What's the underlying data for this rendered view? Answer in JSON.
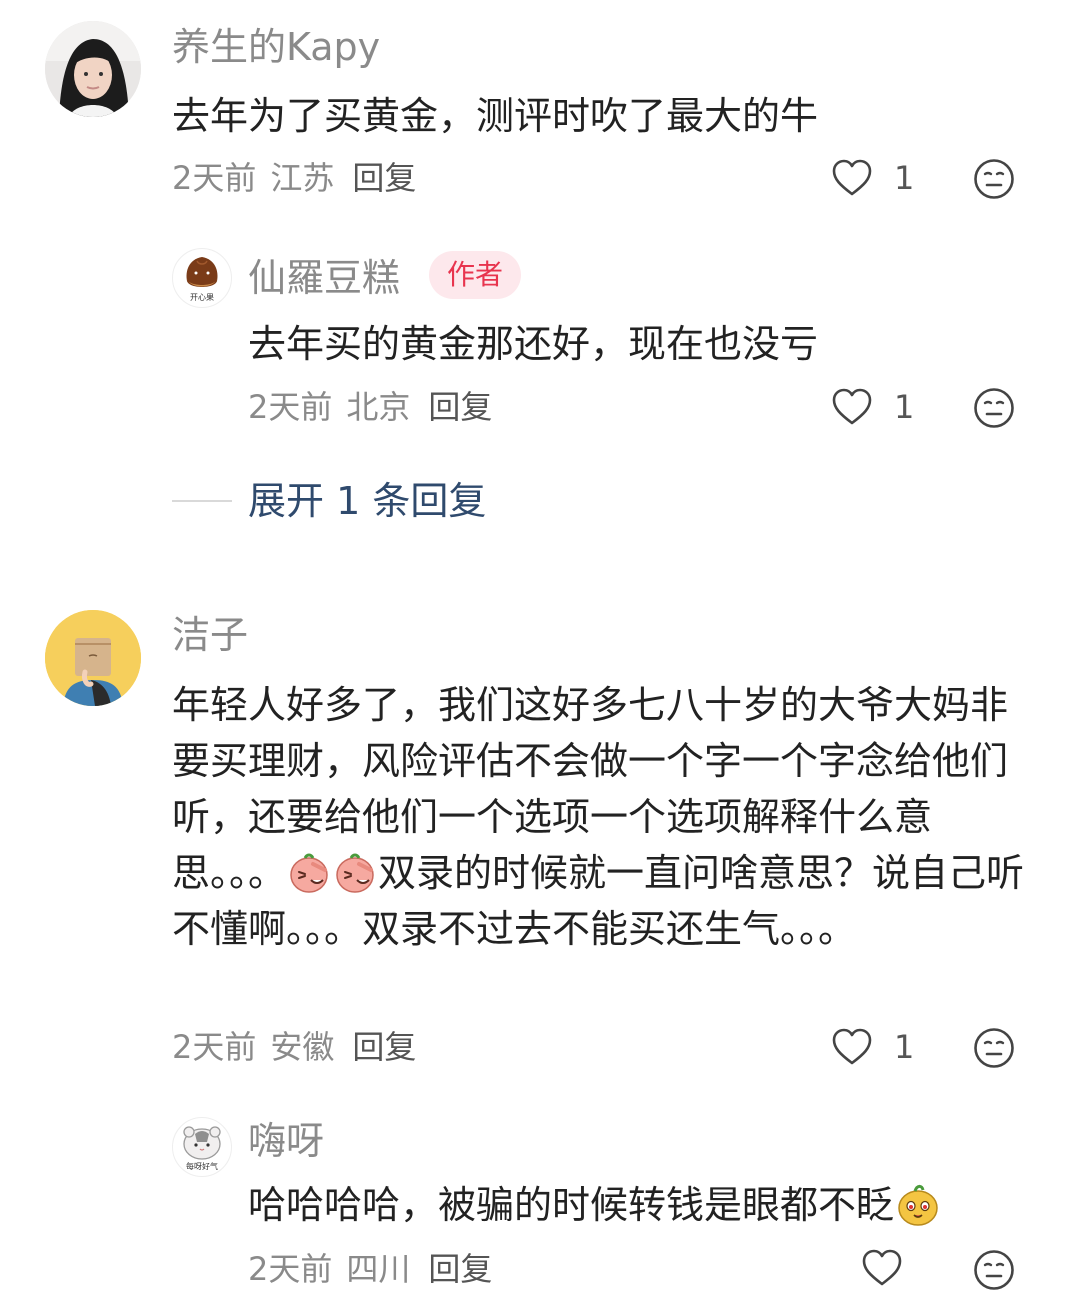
{
  "comments": [
    {
      "name": "养生的Kapy",
      "content": "去年为了买黄金，测评时吹了最大的牛",
      "time": "2天前",
      "location": "江苏",
      "reply_label": "回复",
      "likes": "1",
      "avatar_icon": "woman-photo-avatar",
      "replies": [
        {
          "name": "仙羅豆糕",
          "badge": "作者",
          "content": "去年买的黄金那还好，现在也没亏",
          "time": "2天前",
          "location": "北京",
          "reply_label": "回复",
          "likes": "1",
          "avatar_icon": "chestnut-avatar",
          "avatar_caption": "开心果"
        }
      ],
      "expand_label": "展开 1 条回复"
    },
    {
      "name": "洁子",
      "content_part1": "年轻人好多了，我们这好多七八十岁的大爷大妈非要买理财，风险评估不会做一个字一个字念给他们听，还要给他们一个选项一个选项解释什么意思。。。",
      "content_part2": "双录的时候就一直问啥意思？说自己听不懂啊。。。双录不过去不能买还生气。。。",
      "time": "2天前",
      "location": "安徽",
      "reply_label": "回复",
      "likes": "1",
      "avatar_icon": "girl-with-bag-avatar",
      "inline_emoji": "facepalm-emoji",
      "replies": [
        {
          "name": "嗨呀",
          "content": "哈哈哈哈，被骗的时候转钱是眼都不眨",
          "time": "2天前",
          "location": "四川",
          "reply_label": "回复",
          "likes": "",
          "avatar_icon": "hamster-avatar",
          "avatar_caption": "每呀好气",
          "trailing_emoji": "cute-orange-emoji"
        }
      ]
    }
  ],
  "colors": {
    "meta_gray": "#8a8a8a",
    "text": "#222222",
    "badge_bg": "#fde8ec",
    "badge_text": "#e8344e",
    "expand_text": "#2f4a6d"
  }
}
